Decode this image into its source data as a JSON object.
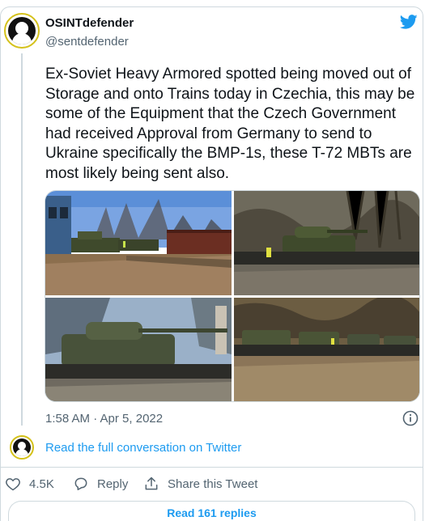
{
  "author": {
    "name": "OSINTdefender",
    "handle": "@sentdefender"
  },
  "tweet": {
    "text": "Ex-Soviet Heavy Armored spotted being moved out of Storage and onto Trains today in Czechia, this may be some of the Equipment that the Czech Government had received Approval from Germany to send to Ukraine specifically the BMP-1s, these T-72 MBTs are most likely being sent also.",
    "timestamp": "1:58 AM · Apr 5, 2022"
  },
  "conversation": {
    "link_label": "Read the full conversation on Twitter"
  },
  "actions": {
    "likes_count": "4.5K",
    "reply_label": "Reply",
    "share_label": "Share this Tweet"
  },
  "replies": {
    "label": "Read 161 replies"
  },
  "colors": {
    "accent": "#1d9bf0",
    "text": "#0f1419",
    "secondary": "#536471",
    "border": "#cfd9de"
  }
}
